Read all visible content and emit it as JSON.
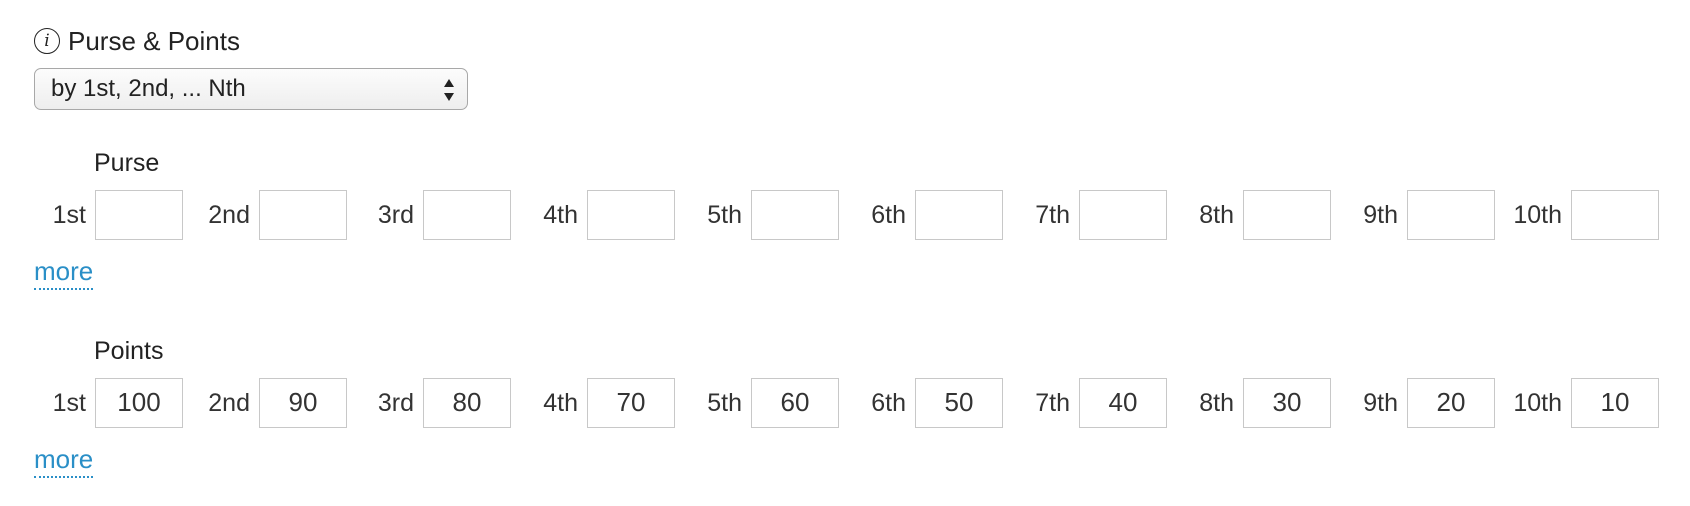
{
  "header": {
    "info_icon": "info-icon",
    "title": "Purse & Points"
  },
  "distribution_select": {
    "value": "by 1st, 2nd, ... Nth"
  },
  "purse": {
    "label": "Purse",
    "places": [
      {
        "label": "1st",
        "value": ""
      },
      {
        "label": "2nd",
        "value": ""
      },
      {
        "label": "3rd",
        "value": ""
      },
      {
        "label": "4th",
        "value": ""
      },
      {
        "label": "5th",
        "value": ""
      },
      {
        "label": "6th",
        "value": ""
      },
      {
        "label": "7th",
        "value": ""
      },
      {
        "label": "8th",
        "value": ""
      },
      {
        "label": "9th",
        "value": ""
      },
      {
        "label": "10th",
        "value": ""
      }
    ],
    "more_label": "more"
  },
  "points": {
    "label": "Points",
    "places": [
      {
        "label": "1st",
        "value": "100"
      },
      {
        "label": "2nd",
        "value": "90"
      },
      {
        "label": "3rd",
        "value": "80"
      },
      {
        "label": "4th",
        "value": "70"
      },
      {
        "label": "5th",
        "value": "60"
      },
      {
        "label": "6th",
        "value": "50"
      },
      {
        "label": "7th",
        "value": "40"
      },
      {
        "label": "8th",
        "value": "30"
      },
      {
        "label": "9th",
        "value": "20"
      },
      {
        "label": "10th",
        "value": "10"
      }
    ],
    "more_label": "more"
  },
  "colors": {
    "link": "#2a8fc7",
    "text": "#222222",
    "input_border": "#c8c8c8"
  }
}
